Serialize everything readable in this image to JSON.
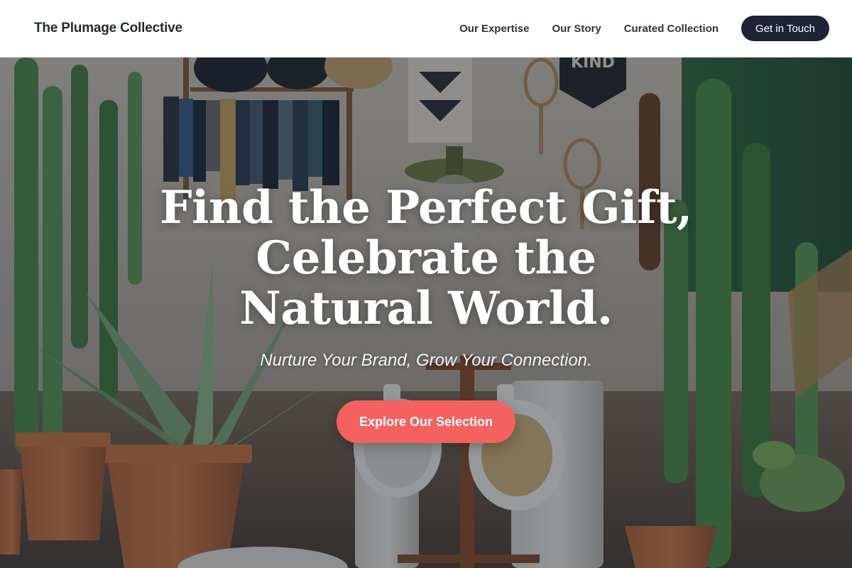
{
  "header": {
    "brand": "The Plumage Collective",
    "nav": [
      {
        "label": "Our Expertise"
      },
      {
        "label": "Our Story"
      },
      {
        "label": "Curated Collection"
      }
    ],
    "cta_label": "Get in Touch"
  },
  "hero": {
    "title": "Find the Perfect Gift, Celebrate the Natural World.",
    "subtitle": "Nurture Your Brand, Grow Your Connection.",
    "cta_label": "Explore Our Selection",
    "sign_text": "KIND"
  },
  "colors": {
    "header_bg": "#ffffff",
    "nav_cta_bg": "#1c2436",
    "hero_cta_bg": "#f4615f",
    "overlay": "rgba(22,28,40,0.42)"
  }
}
